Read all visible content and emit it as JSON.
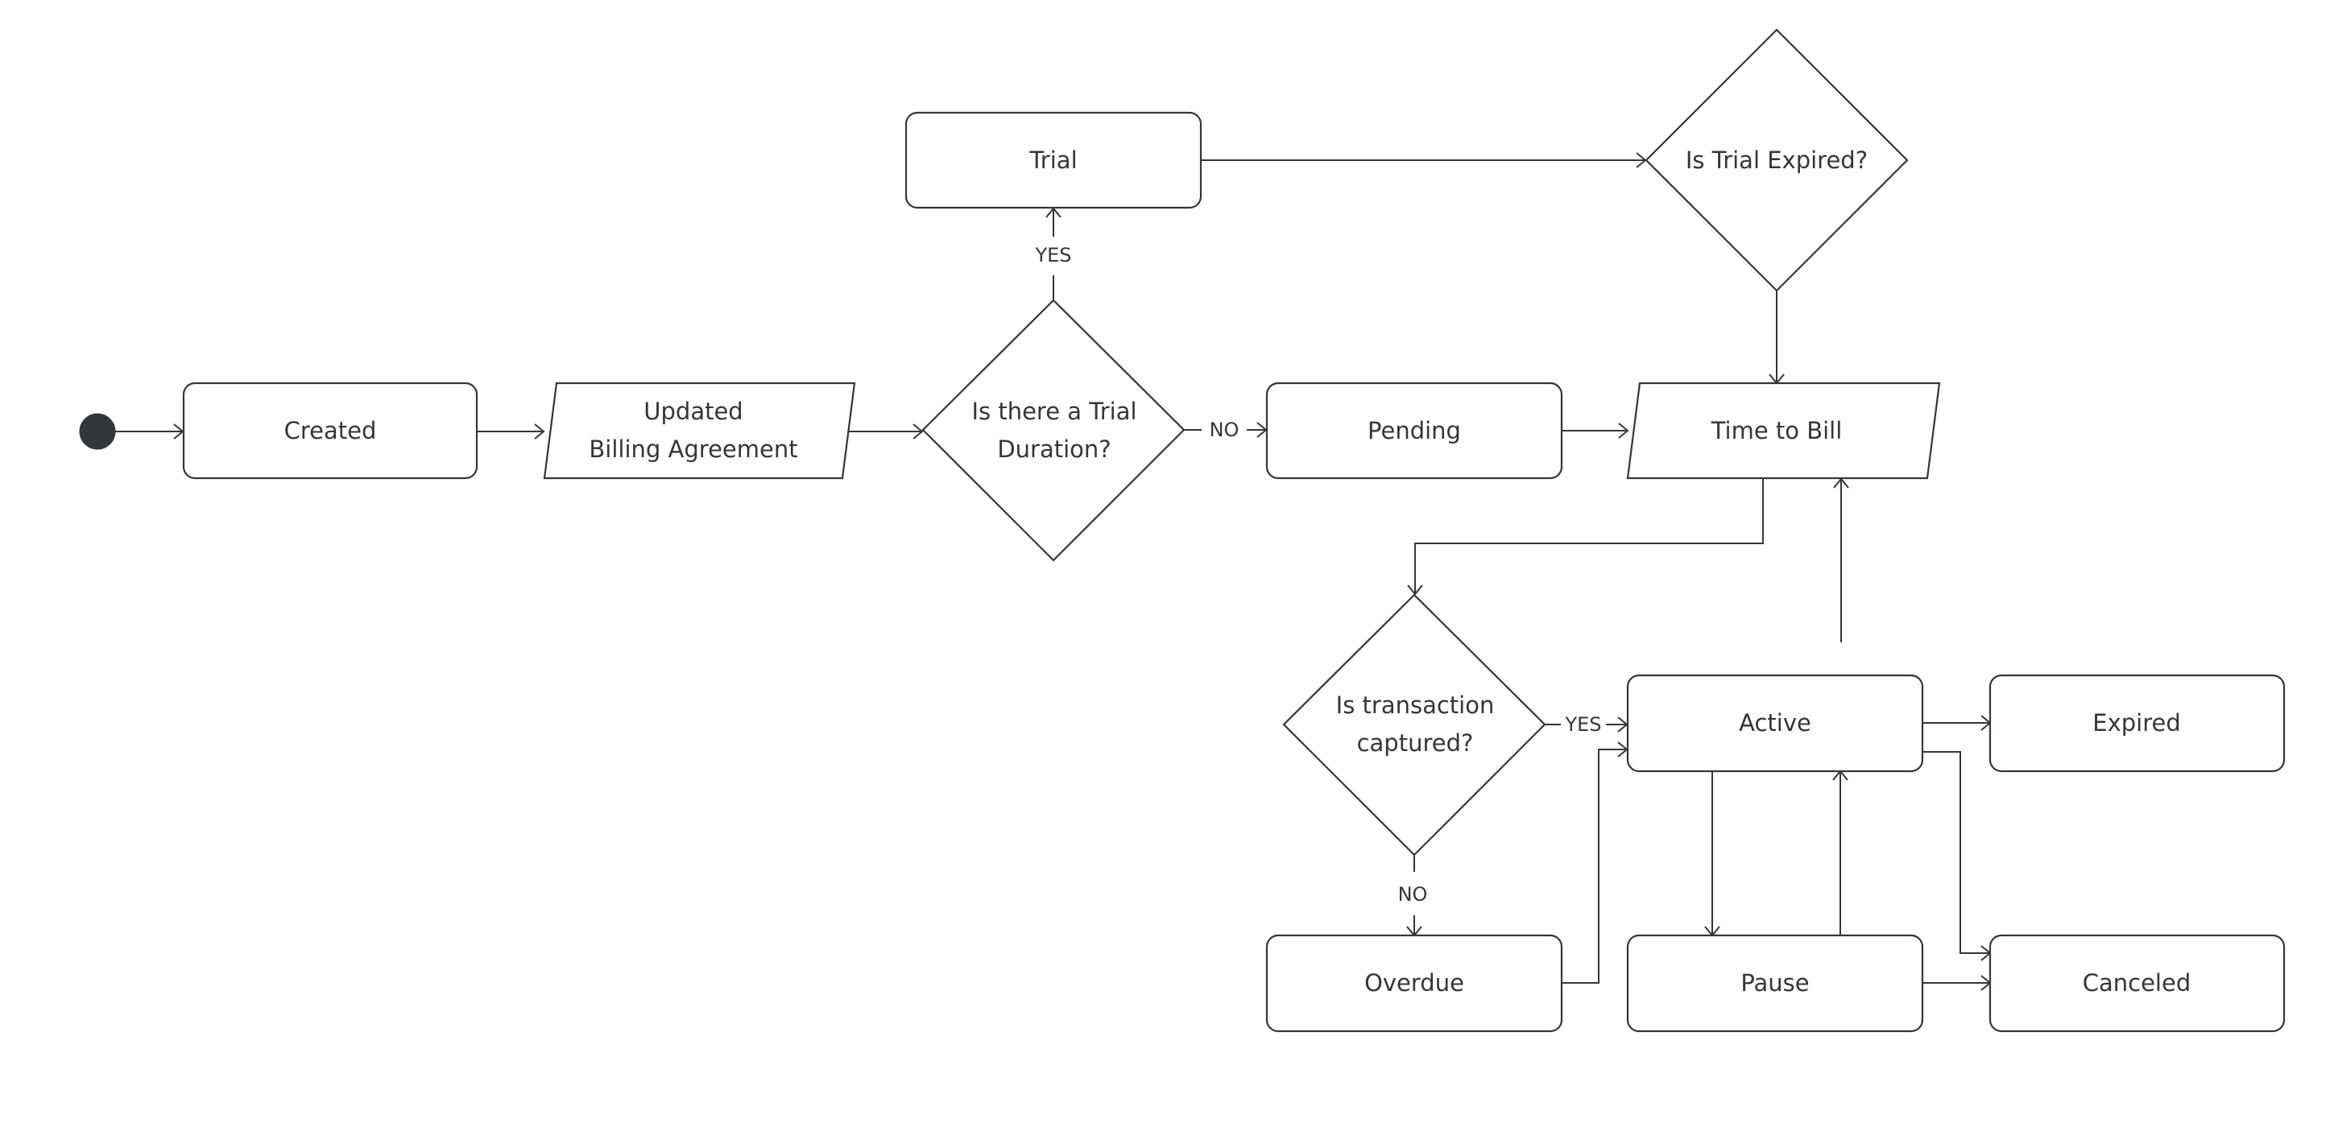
{
  "diagram": {
    "type": "flowchart",
    "colors": {
      "stroke": "#33363b",
      "text": "#33363b",
      "background": "#ffffff",
      "start_node": "#33363b"
    },
    "nodes": [
      {
        "id": "start",
        "kind": "start",
        "label": ""
      },
      {
        "id": "created",
        "kind": "rounded-rect",
        "label": "Created"
      },
      {
        "id": "updated",
        "kind": "parallelogram",
        "label_lines": [
          "Updated",
          "Billing Agreement"
        ]
      },
      {
        "id": "trial-duration",
        "kind": "diamond",
        "label_lines": [
          "Is there a Trial",
          "Duration?"
        ]
      },
      {
        "id": "trial",
        "kind": "rounded-rect",
        "label": "Trial"
      },
      {
        "id": "trial-expired",
        "kind": "diamond",
        "label_lines": [
          "Is Trial Expired?"
        ]
      },
      {
        "id": "pending",
        "kind": "rounded-rect",
        "label": "Pending"
      },
      {
        "id": "time-to-bill",
        "kind": "parallelogram",
        "label_lines": [
          "Time to Bill"
        ]
      },
      {
        "id": "captured",
        "kind": "diamond",
        "label_lines": [
          "Is transaction",
          "captured?"
        ]
      },
      {
        "id": "active",
        "kind": "rounded-rect",
        "label": "Active"
      },
      {
        "id": "expired",
        "kind": "rounded-rect",
        "label": "Expired"
      },
      {
        "id": "overdue",
        "kind": "rounded-rect",
        "label": "Overdue"
      },
      {
        "id": "pause",
        "kind": "rounded-rect",
        "label": "Pause"
      },
      {
        "id": "canceled",
        "kind": "rounded-rect",
        "label": "Canceled"
      }
    ],
    "edges": [
      {
        "from": "start",
        "to": "created",
        "label": ""
      },
      {
        "from": "created",
        "to": "updated",
        "label": ""
      },
      {
        "from": "updated",
        "to": "trial-duration",
        "label": ""
      },
      {
        "from": "trial-duration",
        "to": "trial",
        "label": "YES"
      },
      {
        "from": "trial-duration",
        "to": "pending",
        "label": "NO"
      },
      {
        "from": "trial",
        "to": "trial-expired",
        "label": ""
      },
      {
        "from": "trial-expired",
        "to": "time-to-bill",
        "label": ""
      },
      {
        "from": "pending",
        "to": "time-to-bill",
        "label": ""
      },
      {
        "from": "time-to-bill",
        "to": "captured",
        "label": ""
      },
      {
        "from": "captured",
        "to": "active",
        "label": "YES"
      },
      {
        "from": "captured",
        "to": "overdue",
        "label": "NO"
      },
      {
        "from": "overdue",
        "to": "active",
        "label": ""
      },
      {
        "from": "active",
        "to": "time-to-bill",
        "label": ""
      },
      {
        "from": "active",
        "to": "expired",
        "label": ""
      },
      {
        "from": "active",
        "to": "pause",
        "label": ""
      },
      {
        "from": "pause",
        "to": "active",
        "label": ""
      },
      {
        "from": "active",
        "to": "canceled",
        "label": ""
      },
      {
        "from": "pause",
        "to": "canceled",
        "label": ""
      }
    ]
  }
}
